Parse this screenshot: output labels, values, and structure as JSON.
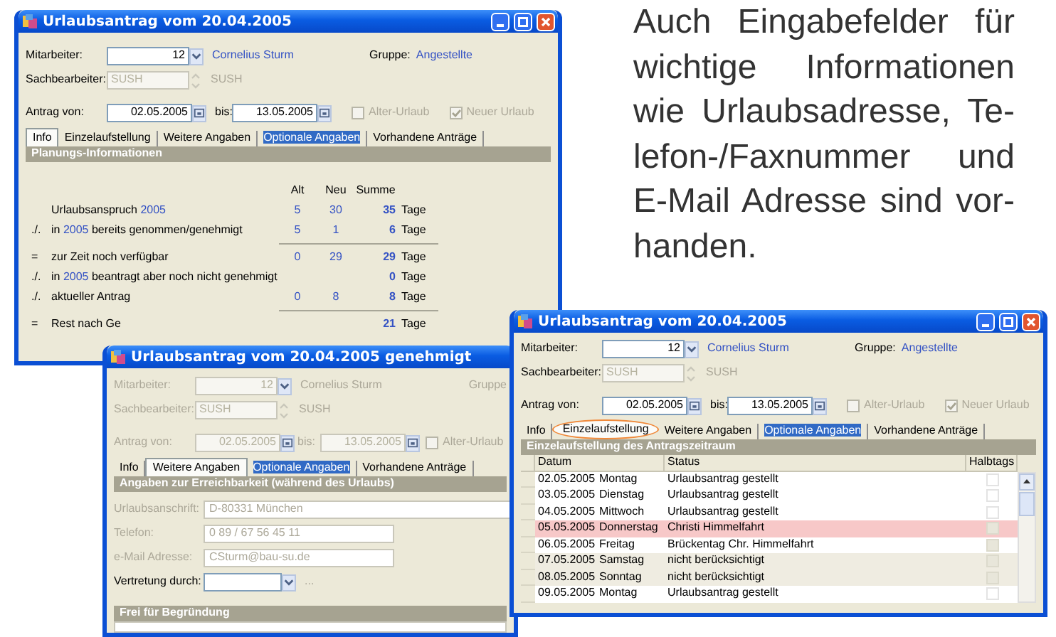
{
  "windows": [
    {
      "kind": "planning",
      "title": "Urlaubsantrag vom 20.04.2005",
      "controls": true,
      "disabled": false,
      "employee": {
        "label": "Mitarbeiter:",
        "number": "12",
        "name": "Cornelius Sturm"
      },
      "group": {
        "label": "Gruppe:",
        "value": "Angestellte"
      },
      "clerk": {
        "label": "Sachbearbeiter:",
        "value": "SUSH",
        "name": "SUSH"
      },
      "period": {
        "from_label": "Antrag von:",
        "from": "02.05.2005",
        "to_label": "bis:",
        "to": "13.05.2005"
      },
      "options": [
        {
          "label": "Alter-Urlaub",
          "checked": false
        },
        {
          "label": "Neuer Urlaub",
          "checked": true
        }
      ],
      "tabs": [
        {
          "label": "Info",
          "selected": true,
          "focused": false,
          "circled": false
        },
        {
          "label": "Einzelaufstellung",
          "selected": false,
          "focused": false,
          "circled": false
        },
        {
          "label": "Weitere Angaben",
          "selected": false,
          "focused": false,
          "circled": false
        },
        {
          "label": "Optionale Angaben",
          "selected": false,
          "focused": true,
          "circled": false
        },
        {
          "label": "Vorhandene Anträge",
          "selected": false,
          "focused": false,
          "circled": false
        }
      ],
      "section": "Planungs-Informationen",
      "planning": {
        "columns": [
          "Alt",
          "Neu",
          "Summe"
        ],
        "rows": [
          {
            "segments": [
              {
                "text": "Urlaubsanspruch",
                "kind": "text"
              },
              {
                "text": "2005",
                "kind": "year"
              }
            ],
            "kind": "row",
            "alt": "5",
            "neu": "30",
            "sum": "35",
            "unit": "Tage"
          },
          {
            "sign": "./.",
            "segments": [
              {
                "text": "in",
                "kind": "text"
              },
              {
                "text": "2005",
                "kind": "year"
              },
              {
                "text": "bereits genommen/genehmigt",
                "kind": "text"
              }
            ],
            "kind": "row",
            "alt": "5",
            "neu": "1",
            "sum": "6",
            "unit": "Tage"
          },
          {
            "kind": "rule"
          },
          {
            "sign": "=",
            "segments": [
              {
                "text": "zur Zeit noch verfügbar",
                "kind": "text"
              }
            ],
            "kind": "row",
            "alt": "0",
            "neu": "29",
            "sum": "29",
            "unit": "Tage"
          },
          {
            "sign": "./.",
            "segments": [
              {
                "text": "in",
                "kind": "text"
              },
              {
                "text": "2005",
                "kind": "year"
              },
              {
                "text": "beantragt aber noch nicht genehmigt",
                "kind": "text"
              }
            ],
            "kind": "row",
            "sum": "0",
            "unit": "Tage"
          },
          {
            "sign": "./.",
            "segments": [
              {
                "text": "aktueller Antrag",
                "kind": "text"
              }
            ],
            "kind": "row",
            "alt": "0",
            "neu": "8",
            "sum": "8",
            "unit": "Tage"
          },
          {
            "kind": "rule"
          },
          {
            "sign": "=",
            "segments": [
              {
                "text": "Rest nach Ge",
                "kind": "text"
              }
            ],
            "kind": "row",
            "sum": "21",
            "unit": "Tage"
          }
        ]
      }
    },
    {
      "kind": "reachability",
      "title": "Urlaubsantrag vom 20.04.2005 genehmigt",
      "controls": false,
      "disabled": true,
      "employee": {
        "label": "Mitarbeiter:",
        "number": "12",
        "name": "Cornelius Sturm"
      },
      "group": {
        "label": "Gruppe"
      },
      "clerk": {
        "label": "Sachbearbeiter:",
        "value": "SUSH",
        "name": "SUSH"
      },
      "period": {
        "from_label": "Antrag von:",
        "from": "02.05.2005",
        "to_label": "bis:",
        "to": "13.05.2005"
      },
      "options": [
        {
          "label": "Alter-Urlaub",
          "checked": false
        }
      ],
      "tabs": [
        {
          "label": "Info",
          "selected": false,
          "focused": false,
          "circled": false
        },
        {
          "label": "Weitere Angaben",
          "selected": true,
          "focused": false,
          "circled": false
        },
        {
          "label": "Optionale Angaben",
          "selected": false,
          "focused": true,
          "circled": false
        },
        {
          "label": "Vorhandene Anträge",
          "selected": false,
          "focused": false,
          "circled": false
        }
      ],
      "section": "Angaben zur Erreichbarkeit (während des Urlaubs)",
      "reachability": {
        "fields": [
          {
            "label": "Urlaubsanschrift:",
            "value": "D-80331 München",
            "disabled": true
          },
          {
            "label": "Telefon:",
            "value": "0 89 / 67 56 45 11",
            "disabled": true
          },
          {
            "label": "e-Mail Adresse:",
            "value": "CSturm@bau-su.de",
            "disabled": true
          }
        ],
        "substitute": {
          "label": "Vertretung durch:",
          "button": "..."
        },
        "notes_section": "Frei für Begründung"
      }
    },
    {
      "kind": "details",
      "title": "Urlaubsantrag vom 20.04.2005",
      "controls": true,
      "disabled": false,
      "employee": {
        "label": "Mitarbeiter:",
        "number": "12",
        "name": "Cornelius Sturm"
      },
      "group": {
        "label": "Gruppe:",
        "value": "Angestellte"
      },
      "clerk": {
        "label": "Sachbearbeiter:",
        "value": "SUSH",
        "name": "SUSH"
      },
      "period": {
        "from_label": "Antrag von:",
        "from": "02.05.2005",
        "to_label": "bis:",
        "to": "13.05.2005"
      },
      "options": [
        {
          "label": "Alter-Urlaub",
          "checked": false
        },
        {
          "label": "Neuer Urlaub",
          "checked": true
        }
      ],
      "tabs": [
        {
          "label": "Info",
          "selected": false,
          "focused": false,
          "circled": false
        },
        {
          "label": "Einzelaufstellung",
          "selected": true,
          "focused": false,
          "circled": true
        },
        {
          "label": "Weitere Angaben",
          "selected": false,
          "focused": false,
          "circled": false
        },
        {
          "label": "Optionale Angaben",
          "selected": false,
          "focused": true,
          "circled": false
        },
        {
          "label": "Vorhandene Anträge",
          "selected": false,
          "focused": false,
          "circled": false
        }
      ],
      "section": "Einzelaufstellung des Antragszeitraum",
      "details": {
        "columns": [
          "Datum",
          "Status",
          "Halbtags"
        ],
        "rows": [
          {
            "date": "02.05.2005",
            "day": "Montag",
            "status": "Urlaubsantrag gestellt",
            "kind": "workday",
            "checked": false
          },
          {
            "date": "03.05.2005",
            "day": "Dienstag",
            "status": "Urlaubsantrag gestellt",
            "kind": "workday",
            "checked": false
          },
          {
            "date": "04.05.2005",
            "day": "Mittwoch",
            "status": "Urlaubsantrag gestellt",
            "kind": "workday",
            "checked": false
          },
          {
            "date": "05.05.2005",
            "day": "Donnerstag",
            "status": "Christi Himmelfahrt",
            "kind": "holiday",
            "checked": false
          },
          {
            "date": "06.05.2005",
            "day": "Freitag",
            "status": "Brückentag Chr. Himmelfahrt",
            "kind": "bridge",
            "checked": false
          },
          {
            "date": "07.05.2005",
            "day": "Samstag",
            "status": "nicht berücksichtigt",
            "kind": "weekend",
            "checked": false
          },
          {
            "date": "08.05.2005",
            "day": "Sonntag",
            "status": "nicht berücksichtigt",
            "kind": "weekend",
            "checked": false
          },
          {
            "date": "09.05.2005",
            "day": "Montag",
            "status": "Urlaubsantrag gestellt",
            "kind": "workday",
            "checked": false
          }
        ]
      }
    }
  ],
  "caption": {
    "lines": [
      "Auch Eingabefelder für",
      "wichtige Informationen",
      "wie Urlaubsadresse, Te-",
      "lefon-/Faxnummer und",
      "E-Mail Adresse sind vor-",
      "handen."
    ]
  }
}
